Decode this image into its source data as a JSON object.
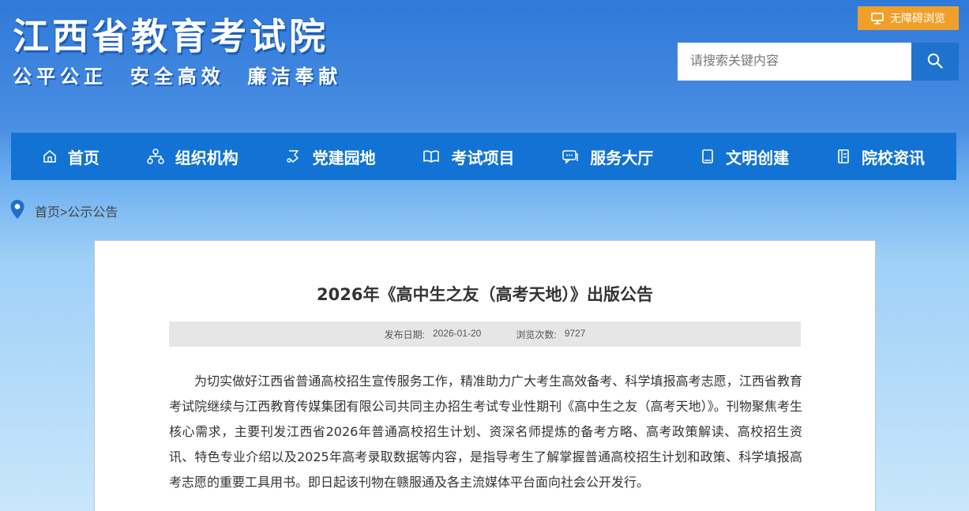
{
  "header": {
    "title": "江西省教育考试院",
    "slogan": "公平公正  安全高效  廉洁奉献",
    "accessibility_label": "无障碍浏览",
    "search_placeholder": "请搜索关键内容"
  },
  "nav": {
    "items": [
      {
        "label": "首页",
        "icon": "home-icon"
      },
      {
        "label": "组织机构",
        "icon": "org-chart-icon"
      },
      {
        "label": "党建园地",
        "icon": "party-building-icon"
      },
      {
        "label": "考试项目",
        "icon": "open-book-icon"
      },
      {
        "label": "服务大厅",
        "icon": "service-chat-icon"
      },
      {
        "label": "文明创建",
        "icon": "notebook-icon"
      },
      {
        "label": "院校资讯",
        "icon": "document-icon"
      }
    ]
  },
  "breadcrumb": {
    "home": "首页",
    "separator": ">",
    "current": "公示公告"
  },
  "article": {
    "title": "2026年《高中生之友（高考天地）》出版公告",
    "publish_label": "发布日期:",
    "publish_date": "2026-01-20",
    "views_label": "浏览次数:",
    "views": "9727",
    "body": "为切实做好江西省普通高校招生宣传服务工作，精准助力广大考生高效备考、科学填报高考志愿，江西省教育考试院继续与江西教育传媒集团有限公司共同主办招生考试专业性期刊《高中生之友（高考天地）》。刊物聚焦考生核心需求，主要刊发江西省2026年普通高校招生计划、资深名师提炼的备考方略、高考政策解读、高校招生资讯、特色专业介绍以及2025年高考录取数据等内容，是指导考生了解掌握普通高校招生计划和政策、科学填报高考志愿的重要工具用书。即日起该刊物在赣服通及各主流媒体平台面向社会公开发行。"
  },
  "colors": {
    "nav_bg": "#1273d4",
    "accessibility_bg": "#f0a02a",
    "search_button_bg": "#1f73cf",
    "breadcrumb_pin": "#1f6fc9"
  }
}
